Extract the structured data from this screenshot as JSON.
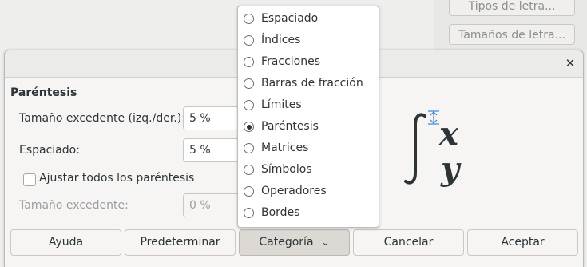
{
  "background_panel": {
    "font_types_button": "Tipos de letra...",
    "font_sizes_button": "Tamaños de letra..."
  },
  "dialog": {
    "section_title": "Paréntesis",
    "excess_size_lr_label": "Tamaño excedente (izq./der.):",
    "excess_size_lr_value": "5 %",
    "spacing_label": "Espaciado:",
    "spacing_value": "5 %",
    "scale_all_label": "Ajustar todos los paréntesis",
    "scale_all_checked": false,
    "excess_size_label": "Tamaño excedente:",
    "excess_size_value": "0 %",
    "preview_symbols": [
      "x",
      "y"
    ]
  },
  "buttons": {
    "help": "Ayuda",
    "default": "Predeterminar",
    "category": "Categoría",
    "cancel": "Cancelar",
    "ok": "Aceptar"
  },
  "category_menu": {
    "selected": "Paréntesis",
    "items": [
      {
        "label": "Espaciado"
      },
      {
        "label": "Índices"
      },
      {
        "label": "Fracciones"
      },
      {
        "label": "Barras de fracción"
      },
      {
        "label": "Límites"
      },
      {
        "label": "Paréntesis"
      },
      {
        "label": "Matrices"
      },
      {
        "label": "Símbolos"
      },
      {
        "label": "Operadores"
      },
      {
        "label": "Bordes"
      }
    ]
  },
  "colors": {
    "preview_arrow": "#3584e4"
  }
}
